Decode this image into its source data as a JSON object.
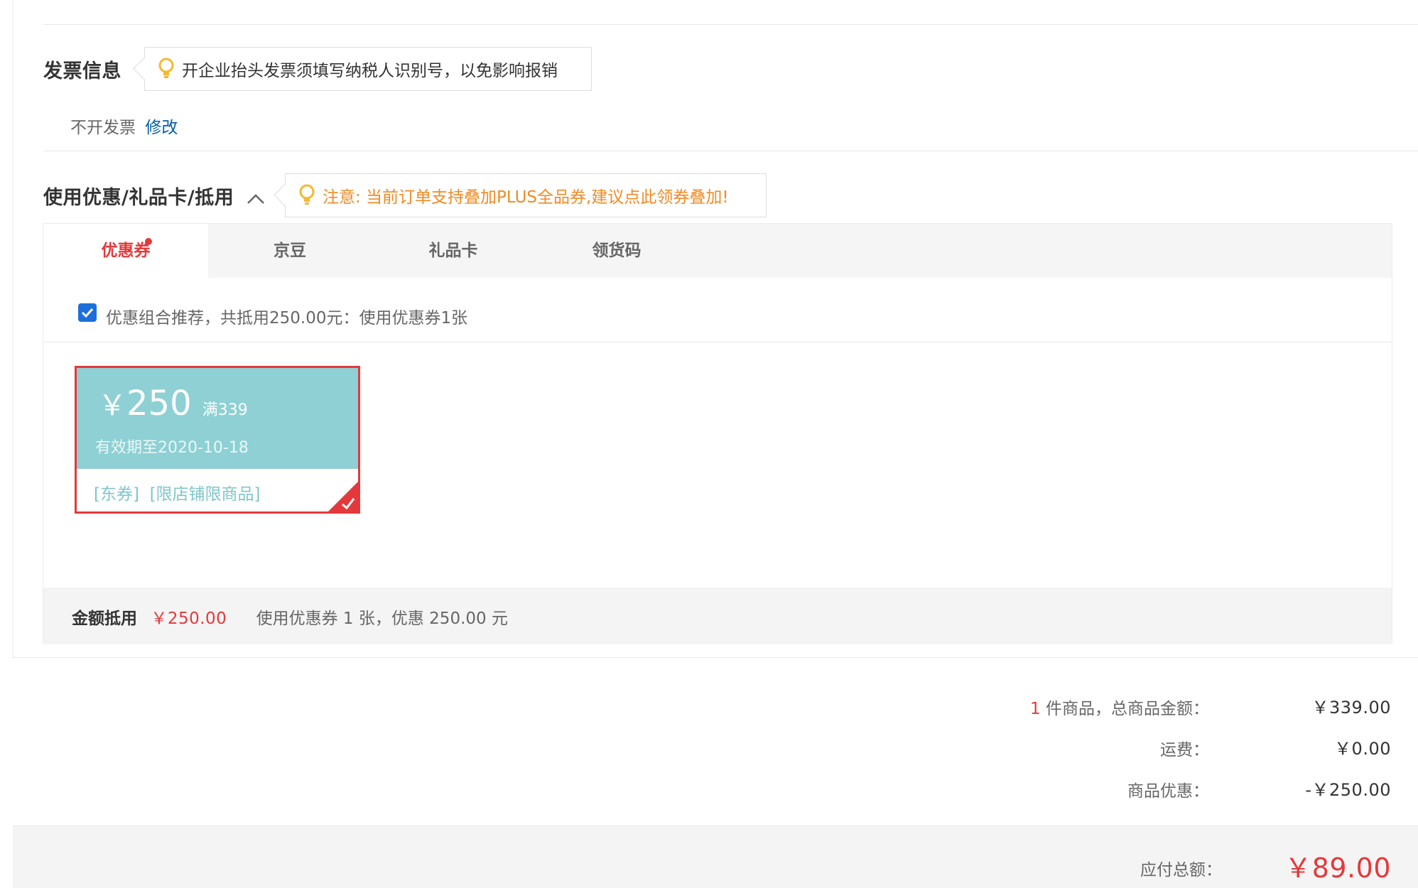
{
  "invoice": {
    "title": "发票信息",
    "tip": "开企业抬头发票须填写纳税人识别号，以免影响报销",
    "current": "不开发票",
    "edit_link": "修改"
  },
  "discount": {
    "title": "使用优惠/礼品卡/抵用",
    "notice": "注意: 当前订单支持叠加PLUS全品券,建议点此领券叠加!",
    "tabs": [
      "优惠券",
      "京豆",
      "礼品卡",
      "领货码"
    ],
    "recommend_text": "优惠组合推荐，共抵用250.00元：使用优惠券1张",
    "coupon": {
      "currency": "￥",
      "amount": "250",
      "threshold": "满339",
      "validity": "有效期至2020-10-18",
      "tags": "[东券]  [限店铺限商品]"
    },
    "footer": {
      "label": "金额抵用",
      "amount": "￥250.00",
      "desc": "使用优惠券 1 张，优惠 250.00 元"
    }
  },
  "summary": {
    "count": "1",
    "goods_label": " 件商品，总商品金额：",
    "goods_value": "￥339.00",
    "shipping_label": "运费：",
    "shipping_value": "￥0.00",
    "discount_label": "商品优惠：",
    "discount_value": "-￥250.00",
    "total_label": "应付总额：",
    "total_value": "￥89.00"
  },
  "colors": {
    "accent_red": "#e4393c",
    "link_blue": "#005ea7",
    "notice_orange": "#f08a24",
    "coupon_teal": "#8ed0d4",
    "checkbox_blue": "#1e6fd9"
  }
}
